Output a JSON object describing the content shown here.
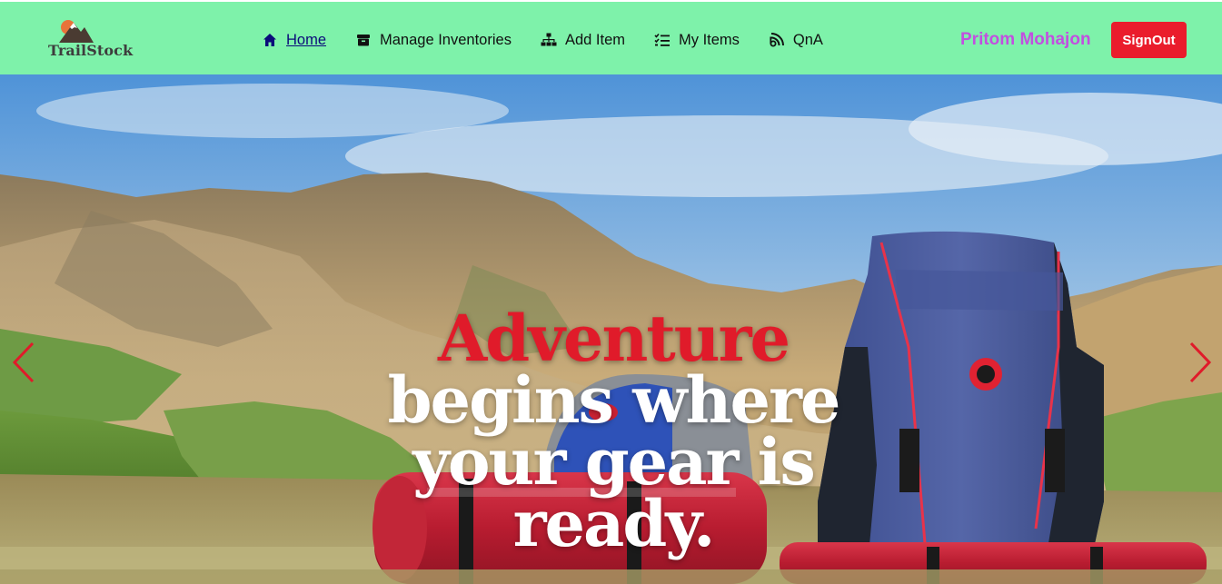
{
  "brand": {
    "name": "TrailStock",
    "logo_icon": "mountain-logo-icon"
  },
  "nav": {
    "items": [
      {
        "label": "Home",
        "icon": "home-icon",
        "active": true
      },
      {
        "label": "Manage Inventories",
        "icon": "archive-box-icon",
        "active": false
      },
      {
        "label": "Add Item",
        "icon": "sitemap-icon",
        "active": false
      },
      {
        "label": "My Items",
        "icon": "checklist-icon",
        "active": false
      },
      {
        "label": "QnA",
        "icon": "blog-feed-icon",
        "active": false
      }
    ]
  },
  "user": {
    "name": "Pritom Mohajon",
    "signout_label": "SignOut"
  },
  "hero": {
    "headline_accent": "Adventure",
    "headline_rest": " begins where your gear is ready.",
    "prev_label": "Previous",
    "next_label": "Next"
  },
  "colors": {
    "navbar_bg": "#7ef2aa",
    "accent_red": "#e01b2a",
    "user_name": "#c24fe0",
    "signout_bg": "#ea1c2c"
  }
}
